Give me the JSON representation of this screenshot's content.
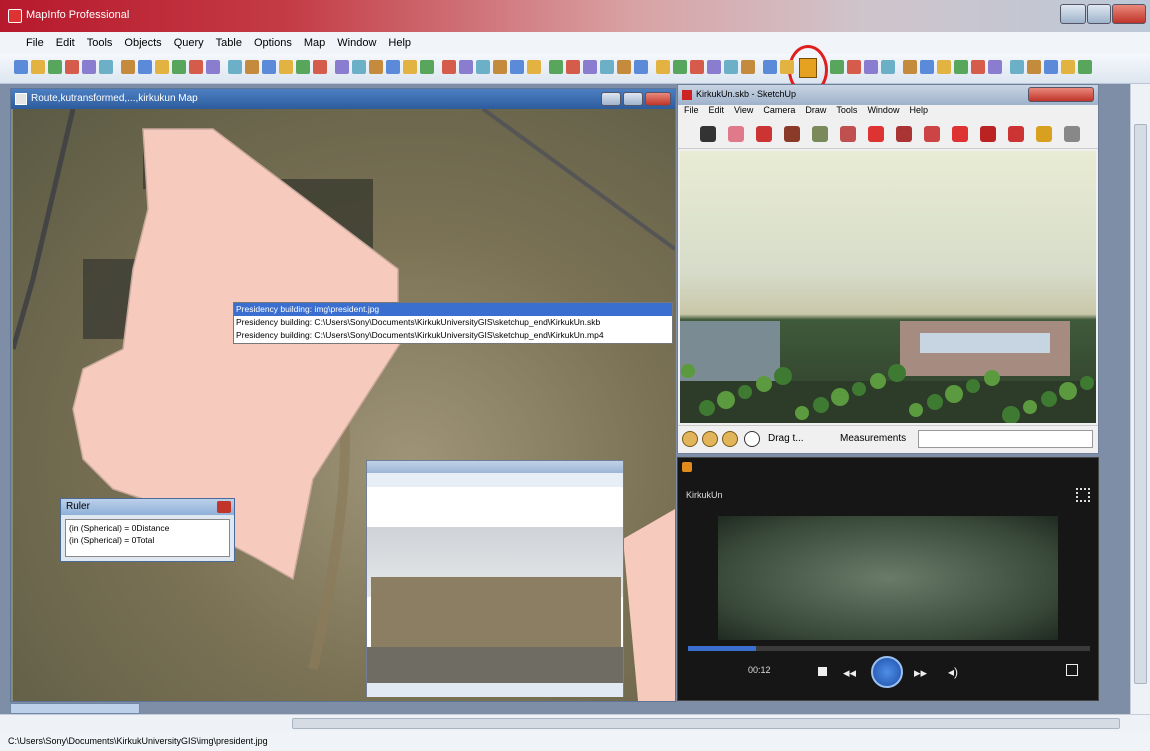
{
  "app": {
    "title": "MapInfo Professional"
  },
  "menu": [
    "File",
    "Edit",
    "Tools",
    "Objects",
    "Query",
    "Table",
    "Options",
    "Map",
    "Window",
    "Help"
  ],
  "map_window": {
    "title": "Route,kutransformed,...,kirkukun Map"
  },
  "popup": {
    "items": [
      "Presidency building: img\\president.jpg",
      "Presidency building: C:\\Users\\Sony\\Documents\\KirkukUniversityGIS\\sketchup_end\\KirkukUn.skb",
      "Presidency building: C:\\Users\\Sony\\Documents\\KirkukUniversityGIS\\sketchup_end\\KirkukUn.mp4"
    ]
  },
  "ruler": {
    "title": "Ruler",
    "lines": [
      "(in (Spherical) = 0Distance",
      "(in (Spherical) = 0Total"
    ]
  },
  "sketchup": {
    "title": "KirkukUn.skb - SketchUp",
    "menu": [
      "File",
      "Edit",
      "View",
      "Camera",
      "Draw",
      "Tools",
      "Window",
      "Help"
    ],
    "status_text": "Drag t...",
    "measurements_label": "Measurements"
  },
  "video": {
    "title": "KirkukUn",
    "time": "00:12",
    "progress": 0.17
  },
  "statusbar": {
    "path": "C:\\Users\\Sony\\Documents\\KirkukUniversityGIS\\img\\president.jpg"
  },
  "colors": {
    "highlight": "#e01e1e",
    "building_fill": "#f6cbbe",
    "selection": "#3a6fcf"
  }
}
